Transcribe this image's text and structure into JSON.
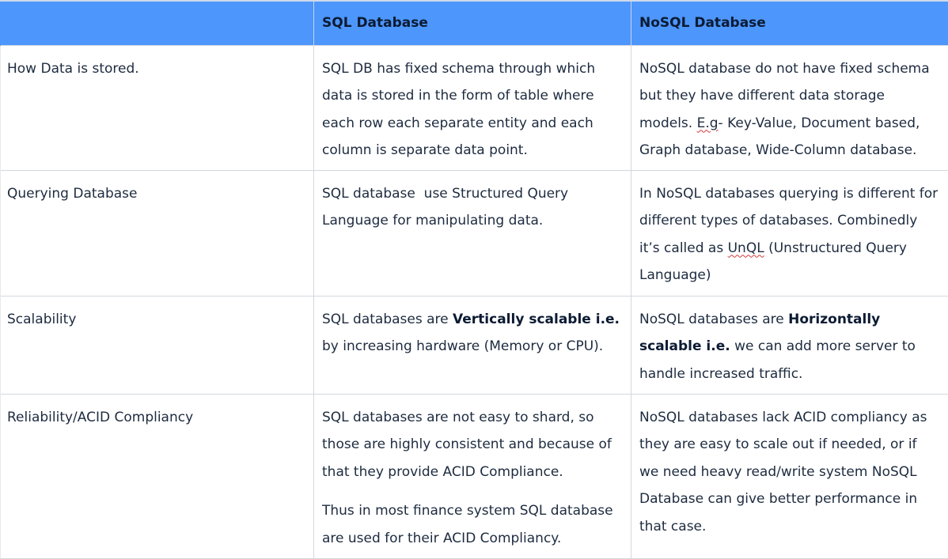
{
  "header": {
    "col1": "",
    "col2": "SQL Database",
    "col3": "NoSQL Database"
  },
  "rows": [
    {
      "aspect": "How Data is stored.",
      "sql": "SQL DB has fixed schema through which data is stored in the form of table where each row each separate entity and each column is separate data point.",
      "nosql_a": "NoSQL database do not have fixed schema but they have different data storage models. ",
      "nosql_b": "E.g",
      "nosql_c": "- Key-Value, Document based, Graph database, Wide-Column database."
    },
    {
      "aspect": "Querying Database",
      "sql": "SQL database  use Structured Query Language for manipulating data.",
      "nosql_a": "In NoSQL databases querying is different for different types of databases. Combinedly it’s called as ",
      "nosql_b": "UnQL",
      "nosql_c": " (Unstructured Query Language)"
    },
    {
      "aspect": "Scalability",
      "sql_a": "SQL databases are ",
      "sql_b": "Vertically scalable i.e.",
      "sql_c": " by increasing hardware (Memory or CPU).",
      "nosql_a": "NoSQL databases are ",
      "nosql_b": "Horizontally scalable i.e.",
      "nosql_c": " we can add more server to handle increased traffic."
    },
    {
      "aspect": "Reliability/ACID Compliancy",
      "sql_p1": "SQL databases are not easy to shard, so those are highly consistent and because of that they provide ACID Compliance.",
      "sql_p2": "Thus in most finance system SQL database are used for their ACID Compliancy.",
      "nosql": "NoSQL databases lack ACID compliancy as they are easy to scale out if needed, or if we need heavy read/write system NoSQL Database can give better performance in that case."
    }
  ]
}
